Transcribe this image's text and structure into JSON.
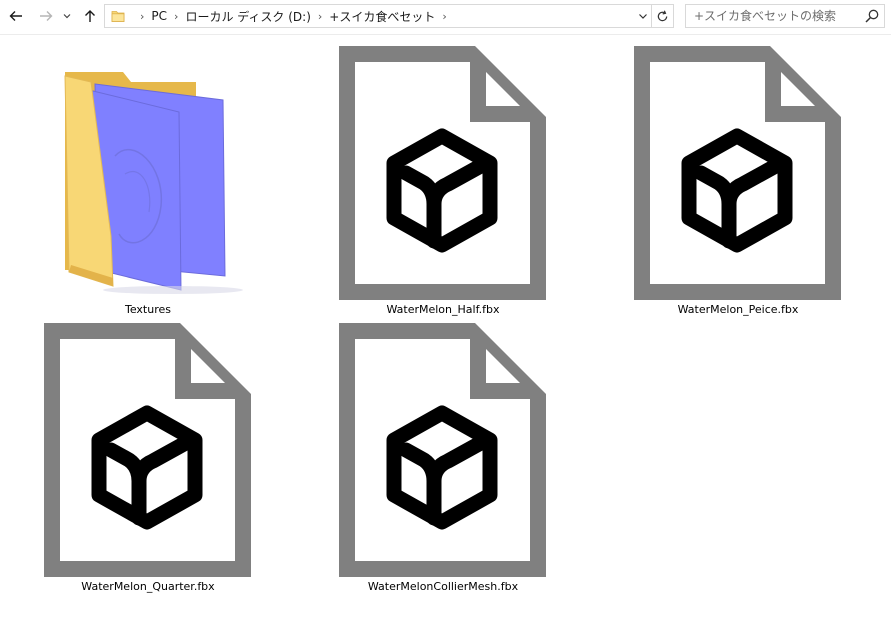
{
  "navigation": {
    "back_icon": "back-arrow-icon",
    "forward_icon": "forward-arrow-icon",
    "recent_icon": "chevron-down-icon",
    "up_icon": "up-arrow-icon"
  },
  "address_bar": {
    "folder_icon": "folder-icon",
    "breadcrumbs": [
      "PC",
      "ローカル ディスク (D:)",
      "+スイカ食べセット"
    ],
    "dropdown_icon": "chevron-down-icon",
    "refresh_icon": "refresh-icon"
  },
  "search": {
    "placeholder": "+スイカ食べセットの検索",
    "value": "",
    "icon": "search-icon"
  },
  "items": [
    {
      "name": "Textures",
      "type": "folder",
      "icon": "folder-icon"
    },
    {
      "name": "WaterMelon_Half.fbx",
      "type": "fbx",
      "icon": "3d-model-file-icon"
    },
    {
      "name": "WaterMelon_Peice.fbx",
      "type": "fbx",
      "icon": "3d-model-file-icon"
    },
    {
      "name": "WaterMelon_Quarter.fbx",
      "type": "fbx",
      "icon": "3d-model-file-icon"
    },
    {
      "name": "WaterMelonCollierMesh.fbx",
      "type": "fbx",
      "icon": "3d-model-file-icon"
    }
  ],
  "colors": {
    "file_icon_gray": "#808080",
    "cube_black": "#000000",
    "folder_yellow": "#f8d775",
    "texture_blue": "#8080ff",
    "border": "#d9d9d9"
  }
}
